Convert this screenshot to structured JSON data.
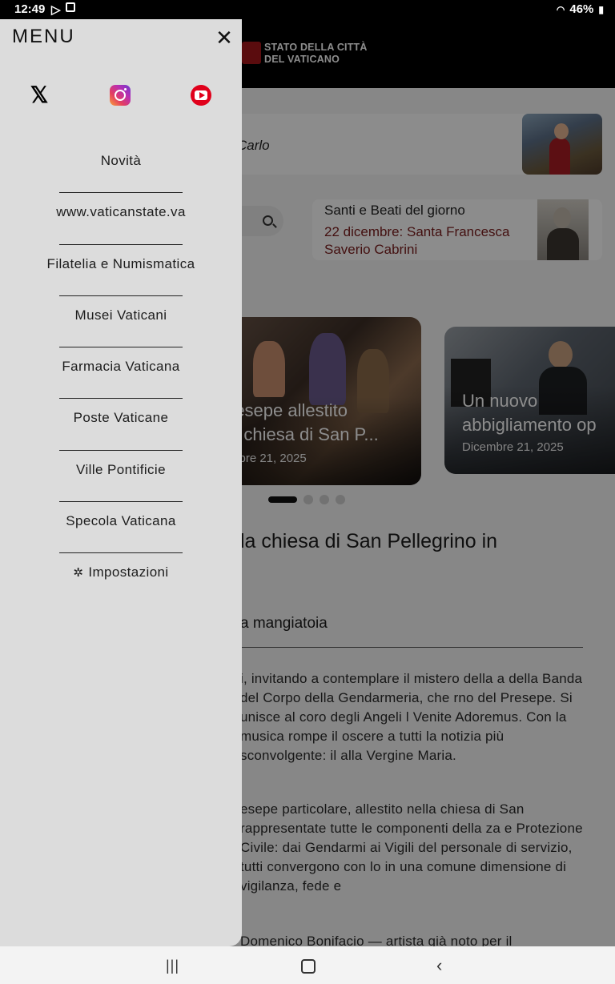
{
  "status_bar": {
    "time": "12:49",
    "battery": "46%"
  },
  "header": {
    "logo_line1": "STATO DELLA CITTÀ",
    "logo_line2": "DEL VATICANO"
  },
  "featured": {
    "title": "Carlo"
  },
  "santi": {
    "heading": "Santi e Beati del giorno",
    "detail": "22 dicembre: Santa Francesca Saverio Cabrini"
  },
  "carousel": {
    "slides": [
      {
        "title": "resepe allestito\na chiesa di San P...",
        "date": "mbre 21, 2025"
      },
      {
        "title": "Un nuovo\nabbigliamento op",
        "date": "Dicembre 21, 2025"
      }
    ],
    "active_index": 0,
    "count": 4
  },
  "article": {
    "title": "la chiesa di San Pellegrino in",
    "subtitle": "a mangiatoia",
    "p1": "i, invitando a contemplare il mistero della a della Banda del Corpo della Gendarmeria, che rno del Presepe. Si unisce al coro degli Angeli l Venite Adoremus. Con la musica rompe il oscere a tutti la notizia più sconvolgente: il alla Vergine Maria.",
    "p2": "esepe particolare, allestito nella chiesa di San rappresentate tutte le componenti della za e Protezione Civile: dai Gendarmi ai Vigili del personale di servizio, tutti convergono con lo in una comune dimensione di vigilanza, fede e",
    "p3": "Domenico Bonifacio — artista già noto per il"
  },
  "drawer": {
    "title": "MENU",
    "close_glyph": "✕",
    "social": [
      "x-icon",
      "instagram-icon",
      "youtube-icon"
    ],
    "items": [
      {
        "label": "Novità"
      },
      {
        "label": "www.vaticanstate.va"
      },
      {
        "label": "Filatelia e Numismatica"
      },
      {
        "label": "Musei Vaticani"
      },
      {
        "label": "Farmacia Vaticana"
      },
      {
        "label": "Poste Vaticane"
      },
      {
        "label": "Ville Pontificie"
      },
      {
        "label": "Specola Vaticana"
      }
    ],
    "settings_label": "Impostazioni"
  },
  "colors": {
    "drawer_bg": "#dcdcdc",
    "header_bg": "#000000",
    "accent_red": "#7a1d1d"
  }
}
